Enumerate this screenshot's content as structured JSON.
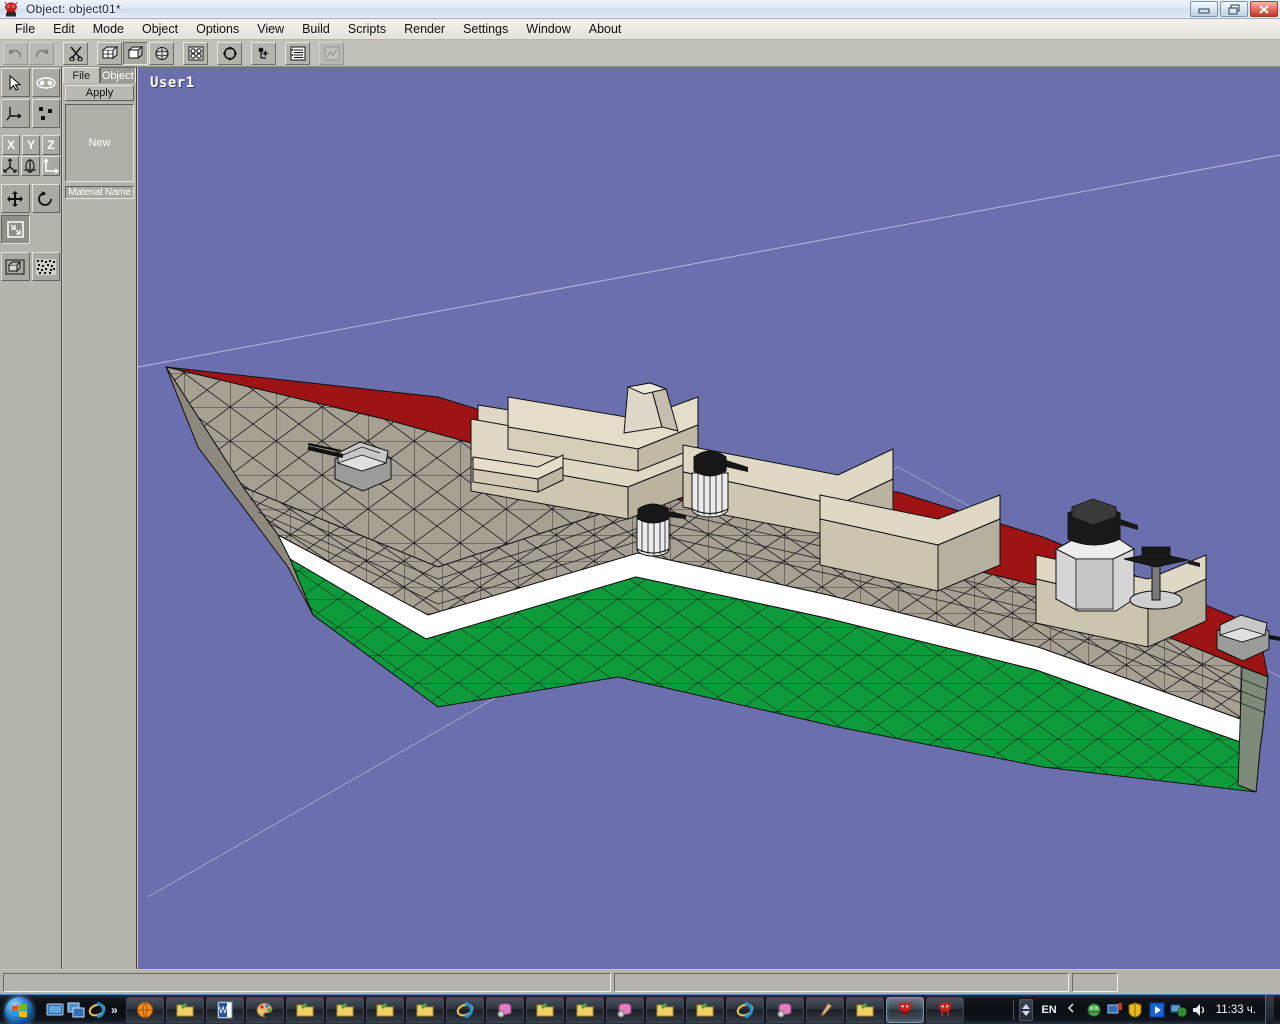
{
  "window": {
    "title": "Object: object01*",
    "app_icon": "devil-mascot-icon",
    "controls": {
      "minimize": "minimize-button",
      "restore": "restore-button",
      "close": "close-button"
    }
  },
  "menubar": {
    "items": [
      {
        "label": "File"
      },
      {
        "label": "Edit"
      },
      {
        "label": "Mode"
      },
      {
        "label": "Object"
      },
      {
        "label": "Options"
      },
      {
        "label": "View"
      },
      {
        "label": "Build"
      },
      {
        "label": "Scripts"
      },
      {
        "label": "Render"
      },
      {
        "label": "Settings"
      },
      {
        "label": "Window"
      },
      {
        "label": "About"
      }
    ]
  },
  "toolbar": {
    "buttons": [
      {
        "name": "undo-icon",
        "state": "disabled"
      },
      {
        "name": "redo-icon",
        "state": "disabled"
      },
      {
        "name": "cut-scissors-icon",
        "state": "normal"
      },
      {
        "name": "wireframe-box-icon",
        "state": "normal"
      },
      {
        "name": "flat-shaded-box-icon",
        "state": "pressed"
      },
      {
        "name": "smooth-sphere-icon",
        "state": "normal"
      },
      {
        "name": "four-points-icon",
        "state": "normal"
      },
      {
        "name": "circle-points-icon",
        "state": "normal"
      },
      {
        "name": "light-point-icon",
        "state": "normal"
      },
      {
        "name": "list-lines-icon",
        "state": "normal"
      },
      {
        "name": "graph-curve-icon",
        "state": "disabled"
      }
    ]
  },
  "tool_palette": {
    "rows": [
      [
        {
          "name": "arrow-select-icon",
          "active": false
        },
        {
          "name": "eye-view-icon",
          "active": false
        }
      ],
      [
        {
          "name": "axis-tripod-icon",
          "active": false
        },
        {
          "name": "points-scatter-icon",
          "active": false
        }
      ]
    ],
    "axis_buttons": [
      {
        "label": "X"
      },
      {
        "label": "Y"
      },
      {
        "label": "Z"
      }
    ],
    "axis_mode_icons": [
      {
        "name": "global-axis-icon"
      },
      {
        "name": "local-axis-icon"
      },
      {
        "name": "corner-axis-icon"
      }
    ],
    "transform_icons": [
      {
        "name": "move-arrows-icon"
      },
      {
        "name": "rotate-arrow-icon"
      }
    ],
    "scale_icons": [
      {
        "name": "scale-box-icon"
      }
    ],
    "display_icons": [
      {
        "name": "solid-cube-icon"
      },
      {
        "name": "textured-cube-icon"
      }
    ]
  },
  "material_panel": {
    "tabs": [
      {
        "label": "File",
        "active": false
      },
      {
        "label": "Object",
        "active": true
      }
    ],
    "apply_label": "Apply",
    "list_items": [
      {
        "label": "New"
      }
    ],
    "material_name_label": "Material Name"
  },
  "viewport": {
    "label": "User1",
    "background_color": "#6b6fae",
    "scene": {
      "model": "naval-warship-destroyer",
      "hull_bands": [
        {
          "name": "deck-red",
          "color": "#9e1414"
        },
        {
          "name": "hull-grey",
          "color": "#a09a8b"
        },
        {
          "name": "waterline-white",
          "color": "#ffffff"
        },
        {
          "name": "antifoul-green",
          "color": "#0e9b3c"
        }
      ],
      "superstructure_color": "#ded8c4",
      "wireframe_color": "#000000",
      "ground_axis_color": "#d8d8ea",
      "parts": [
        {
          "name": "bow-main-gun-turret"
        },
        {
          "name": "forward-superstructure-block"
        },
        {
          "name": "funnel-stack"
        },
        {
          "name": "forward-ciws-mount"
        },
        {
          "name": "midship-ciws-mount"
        },
        {
          "name": "aft-superstructure-block"
        },
        {
          "name": "aft-radar-dome"
        },
        {
          "name": "aft-rotating-radar"
        },
        {
          "name": "stern-gun-turret"
        }
      ]
    }
  },
  "statusbar": {
    "panes": [
      {
        "text": ""
      },
      {
        "text": ""
      },
      {
        "text": ""
      }
    ]
  },
  "taskbar": {
    "start_label": "start-orb-icon",
    "quick_launch": [
      {
        "name": "show-desktop-icon"
      },
      {
        "name": "switch-window-icon"
      },
      {
        "name": "internet-explorer-icon"
      }
    ],
    "overflow_label": "»",
    "task_buttons": [
      {
        "name": "taskbtn-orange-globe",
        "active": false
      },
      {
        "name": "taskbtn-folder-1",
        "active": false
      },
      {
        "name": "taskbtn-word-document",
        "active": false
      },
      {
        "name": "taskbtn-paint-palette",
        "active": false
      },
      {
        "name": "taskbtn-folder-2",
        "active": false
      },
      {
        "name": "taskbtn-folder-3",
        "active": false
      },
      {
        "name": "taskbtn-folder-4",
        "active": false
      },
      {
        "name": "taskbtn-folder-5",
        "active": false
      },
      {
        "name": "taskbtn-internet-explorer-1",
        "active": false
      },
      {
        "name": "taskbtn-database-1",
        "active": false
      },
      {
        "name": "taskbtn-folder-6",
        "active": false
      },
      {
        "name": "taskbtn-folder-7",
        "active": false
      },
      {
        "name": "taskbtn-database-2",
        "active": false
      },
      {
        "name": "taskbtn-folder-8",
        "active": false
      },
      {
        "name": "taskbtn-folder-9",
        "active": false
      },
      {
        "name": "taskbtn-internet-explorer-2",
        "active": false
      },
      {
        "name": "taskbtn-database-3",
        "active": false
      },
      {
        "name": "taskbtn-paint-brush",
        "active": false
      },
      {
        "name": "taskbtn-folder-10",
        "active": false
      },
      {
        "name": "taskbtn-anim8or-active",
        "active": true
      },
      {
        "name": "taskbtn-anim8or-2",
        "active": false
      }
    ],
    "tray": {
      "language": "EN",
      "icons": [
        {
          "name": "tray-chevron-icon"
        },
        {
          "name": "tray-green-shield-icon"
        },
        {
          "name": "tray-monitor-flag-icon"
        },
        {
          "name": "tray-yellow-shield-icon"
        },
        {
          "name": "tray-blue-play-icon"
        },
        {
          "name": "tray-network-icon"
        },
        {
          "name": "tray-volume-icon"
        }
      ],
      "clock": "11:33 ч."
    }
  }
}
